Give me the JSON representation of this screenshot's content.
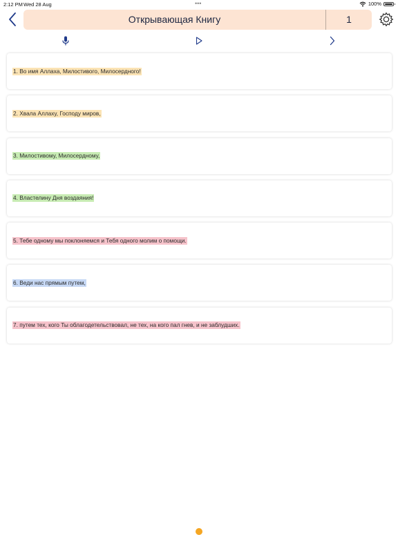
{
  "status": {
    "time": "2:12 PM",
    "date": "Wed 28 Aug",
    "dots": "•••",
    "battery": "100%"
  },
  "header": {
    "title": "Открывающая Книгу",
    "number": "1"
  },
  "colors": {
    "title_bg": "#fde4d3",
    "accent": "#1f3a8a",
    "orange": "#f5a623"
  },
  "icons": {
    "back": "chevron-left-icon",
    "settings": "gear-icon",
    "mic": "microphone-icon",
    "play": "play-icon",
    "next": "chevron-right-icon"
  },
  "verses": [
    {
      "text": "1. Во имя Аллаха, Милостивого, Милосердного!",
      "highlight": "#fbe3b4"
    },
    {
      "text": "2. Хвала Аллаху, Господу миров,",
      "highlight": "#fbe3b4"
    },
    {
      "text": "3. Милостивому, Милосердному,",
      "highlight": "#c8ecb4"
    },
    {
      "text": "4. Властелину Дня воздаяния!",
      "highlight": "#c8ecb4"
    },
    {
      "text": "5. Тебе одному мы поклоняемся и Тебя одного молим о помощи.",
      "highlight": "#f6c3cb"
    },
    {
      "text": "6. Веди нас прямым путем,",
      "highlight": "#c6d8f5"
    },
    {
      "text": "7. путем тех, кого Ты облагодетельствовал, не тех, на кого пал гнев, и не заблудших.",
      "highlight": "#f6c3cb"
    }
  ]
}
